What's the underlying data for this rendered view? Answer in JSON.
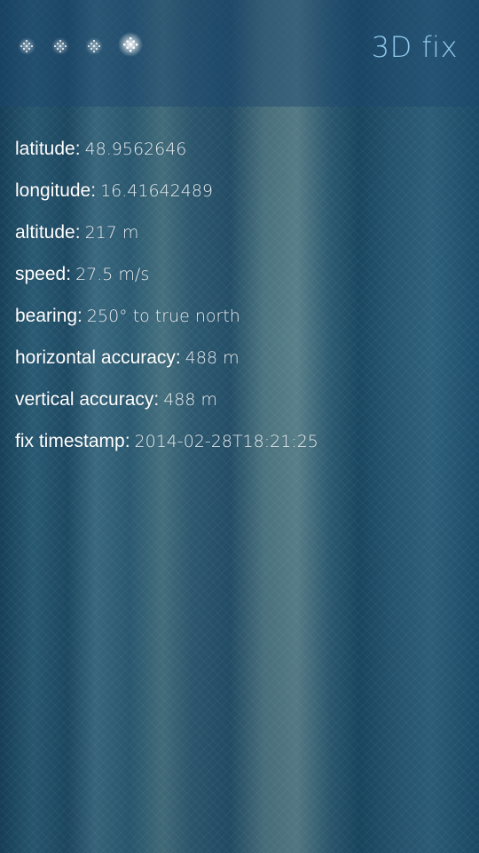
{
  "header": {
    "status_title": "3D fix",
    "title_color": "#8fc8ec",
    "signal_indicators": [
      {
        "icon": "satellite-dot-icon",
        "active": false
      },
      {
        "icon": "satellite-dot-icon",
        "active": false
      },
      {
        "icon": "satellite-dot-icon",
        "active": false
      },
      {
        "icon": "satellite-dot-icon",
        "active": true
      }
    ]
  },
  "fields": [
    {
      "label": "latitude:",
      "value": "48.9562646"
    },
    {
      "label": "longitude:",
      "value": "16.41642489"
    },
    {
      "label": "altitude:",
      "value": "217 m"
    },
    {
      "label": "speed:",
      "value": "27.5 m/s"
    },
    {
      "label": "bearing:",
      "value": "250° to true north"
    },
    {
      "label": "horizontal accuracy:",
      "value": "488 m"
    },
    {
      "label": "vertical accuracy:",
      "value": "488 m"
    },
    {
      "label": "fix timestamp:",
      "value": "2014-02-28T18:21:25"
    }
  ]
}
